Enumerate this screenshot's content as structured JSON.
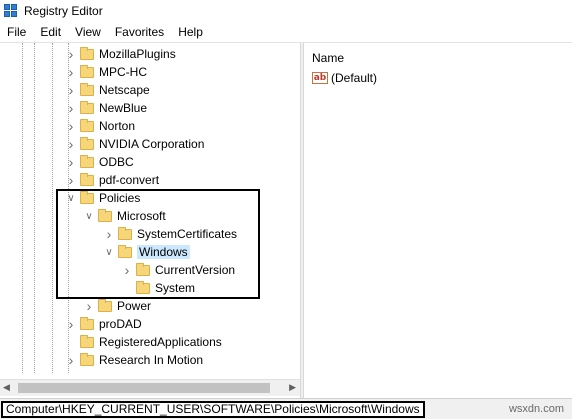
{
  "window": {
    "title": "Registry Editor"
  },
  "menu": [
    "File",
    "Edit",
    "View",
    "Favorites",
    "Help"
  ],
  "tree": [
    {
      "label": "MozillaPlugins",
      "level": 0,
      "chevron": ">"
    },
    {
      "label": "MPC-HC",
      "level": 0,
      "chevron": ">"
    },
    {
      "label": "Netscape",
      "level": 0,
      "chevron": ">"
    },
    {
      "label": "NewBlue",
      "level": 0,
      "chevron": ">"
    },
    {
      "label": "Norton",
      "level": 0,
      "chevron": ">"
    },
    {
      "label": "NVIDIA Corporation",
      "level": 0,
      "chevron": ">"
    },
    {
      "label": "ODBC",
      "level": 0,
      "chevron": ">"
    },
    {
      "label": "pdf-convert",
      "level": 0,
      "chevron": ">"
    },
    {
      "label": "Policies",
      "level": 0,
      "chevron": "v"
    },
    {
      "label": "Microsoft",
      "level": 1,
      "chevron": "v"
    },
    {
      "label": "SystemCertificates",
      "level": 2,
      "chevron": ">"
    },
    {
      "label": "Windows",
      "level": 2,
      "chevron": "v",
      "selected": true
    },
    {
      "label": "CurrentVersion",
      "level": 3,
      "chevron": ">"
    },
    {
      "label": "System",
      "level": 3,
      "chevron": ""
    },
    {
      "label": "Power",
      "level": 1,
      "chevron": ">"
    },
    {
      "label": "proDAD",
      "level": 0,
      "chevron": ">"
    },
    {
      "label": "RegisteredApplications",
      "level": 0,
      "chevron": ""
    },
    {
      "label": "Research In Motion",
      "level": 0,
      "chevron": ">"
    }
  ],
  "list": {
    "column_name": "Name",
    "values": [
      {
        "icon": "ab",
        "name": "(Default)"
      }
    ]
  },
  "status": {
    "path": "Computer\\HKEY_CURRENT_USER\\SOFTWARE\\Policies\\Microsoft\\Windows"
  },
  "watermark": "wsxdn.com"
}
